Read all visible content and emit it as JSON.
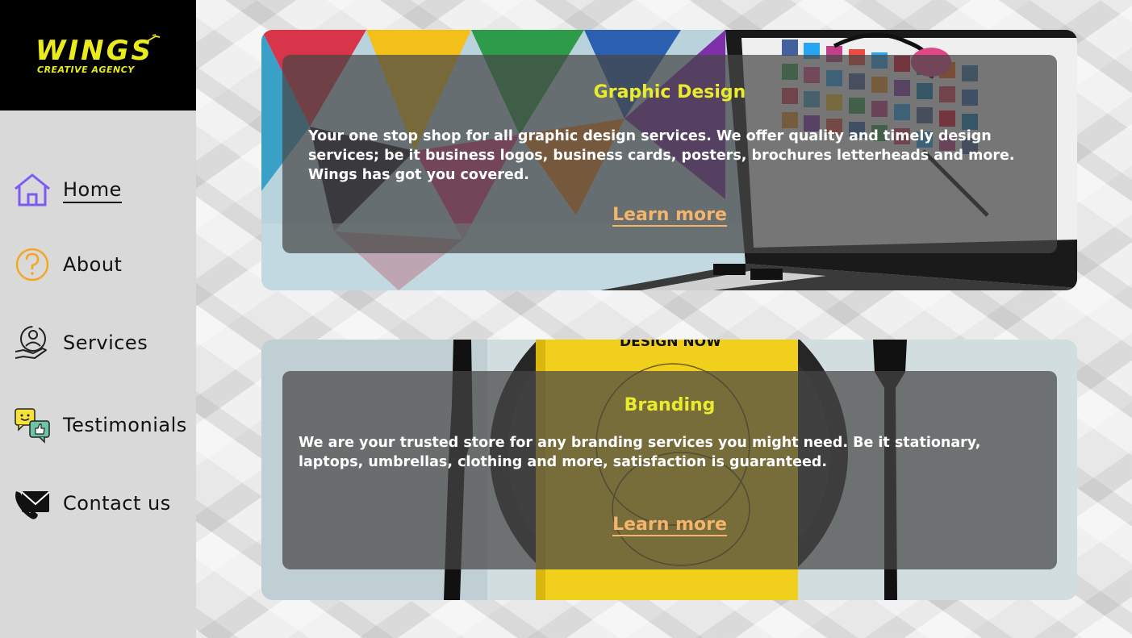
{
  "brand": {
    "name": "WINGS",
    "tagline": "CREATIVE AGENCY",
    "accent": "#e9ec1a"
  },
  "nav": [
    {
      "label": "Home",
      "icon": "house-icon",
      "active": true
    },
    {
      "label": "About",
      "icon": "question-icon",
      "active": false
    },
    {
      "label": "Services",
      "icon": "service-hand-icon",
      "active": false
    },
    {
      "label": "Testimonials",
      "icon": "chat-thumbs-icon",
      "active": false
    },
    {
      "label": "Contact us",
      "icon": "phone-envelope-icon",
      "active": false
    }
  ],
  "cards": [
    {
      "title": "Graphic Design",
      "text": "Your one stop shop for all graphic design services. We offer quality and timely design services; be it business logos, business cards, posters, brochures letterheads and more. Wings has got you covered.",
      "link": "Learn more",
      "image": "laptop-colorful-screen"
    },
    {
      "title": "Branding",
      "text": "We are your trusted store for any branding services you might need. Be it stationary, laptops, umbrellas, clothing and more, satisfaction is guaranteed.",
      "link": "Learn more",
      "image": "plate-book-cutlery",
      "book_title": "DESIGN NOW"
    }
  ],
  "colors": {
    "title": "#eaeb2c",
    "link": "#f4b46a",
    "sidebar": "#d9d9d9"
  }
}
